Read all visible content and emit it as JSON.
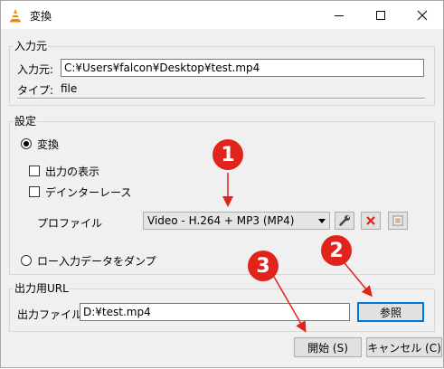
{
  "window": {
    "title": "変換"
  },
  "source_group": {
    "title": "入力元",
    "source_label": "入力元:",
    "source_value": "C:¥Users¥falcon¥Desktop¥test.mp4",
    "type_label": "タイプ:",
    "type_value": "file"
  },
  "settings_group": {
    "title": "設定",
    "convert_label": "変換",
    "show_output_label": "出力の表示",
    "deinterlace_label": "デインターレース",
    "profile_label": "プロファイル",
    "profile_value": "Video - H.264 + MP3 (MP4)",
    "dump_label": "ロー入力データをダンプ"
  },
  "output_group": {
    "title": "出力用URL",
    "file_label": "出力ファイル:",
    "file_value": "D:¥test.mp4",
    "browse_label": "参照"
  },
  "buttons": {
    "start": "開始 (S)",
    "cancel": "キャンセル (C)"
  },
  "annotations": [
    "1",
    "2",
    "3"
  ],
  "colors": {
    "annotation": "#e0241c",
    "focus": "#0078d7"
  }
}
